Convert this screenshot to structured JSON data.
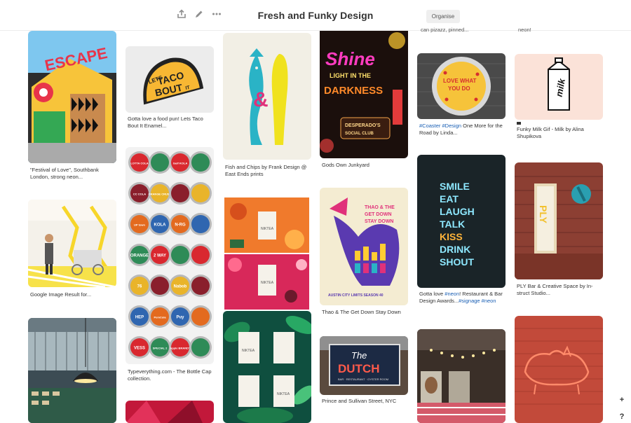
{
  "board": {
    "title": "Fresh and Funky Design",
    "organise_label": "Organise"
  },
  "toolbar": {
    "share_icon": "share-icon",
    "edit_icon": "pencil-icon",
    "more_icon": "more-icon"
  },
  "faded_captions": {
    "col5": "can pizazz, pinned...",
    "col6": "neon!"
  },
  "pins": {
    "festival": {
      "caption": "\"Festival of Love\", Southbank London, strong neon...",
      "sign_text": "ESCAPE"
    },
    "taco": {
      "caption": "Gotta love a food pun! Lets Taco Bout It Enamel...",
      "sign_text": [
        "LETS",
        "TACO",
        "BOUT",
        "IT"
      ]
    },
    "fish": {
      "caption": "Fish and Chips by Frank Design @ East Ends prints"
    },
    "shine": {
      "caption": "Gods Own Junkyard",
      "sign_lines": [
        "Shine",
        "LIGHT IN THE",
        "DARKNESS",
        "DESPERADO'S",
        "SOCIAL CLUB"
      ]
    },
    "coaster": {
      "caption_tag": "#Coaster #Design",
      "caption_rest": " One More for the Road by Linda...",
      "sign_lines": [
        "LOVE WHAT",
        "YOU DO"
      ]
    },
    "milk": {
      "caption_icon": "pin-source-icon",
      "caption": "Funky Milk Gif - Milk by Alina Shupikova",
      "sign_text": "milk"
    },
    "kiosk": {
      "caption": "Google Image Result for..."
    },
    "caps": {
      "caption": "Typeverything.com - The Bottle Cap collection.",
      "labels": [
        "LOTTA COLA",
        "",
        "Gulf KOLA",
        "",
        "CC COLA",
        "ORANGE CRUSH",
        "",
        "",
        "UP town",
        "KOLA",
        "N-RG",
        "",
        "ORANGE",
        "2 WAY",
        "",
        "",
        "76",
        "",
        "Nabob",
        "",
        "HEP",
        "PemCola",
        "Puy",
        "",
        "VESS",
        "SPECIAL 2",
        "Apple BRANDY",
        ""
      ]
    },
    "thao": {
      "caption": "Thao & The Get Down Stay Down",
      "sign_lines": [
        "THAO & THE",
        "GET DOWN",
        "STAY DOWN",
        "AUSTIN CITY LIMITS SEASON 40"
      ]
    },
    "neon": {
      "caption_a": "Gotta love ",
      "caption_tag1": "#neon",
      "caption_b": "! Restaurant & Bar Design Awards...",
      "caption_tag2": "#signage #neon",
      "sign_lines": [
        "SMILE",
        "EAT",
        "LAUGH",
        "TALK",
        "KISS",
        "DRINK",
        "SHOUT"
      ]
    },
    "ply": {
      "caption": "PLY Bar & Creative Space by In-struct Studio...",
      "sign_text": "PLY"
    },
    "dutch": {
      "caption": "Prince and Sullivan Street, NYC",
      "sign_lines": [
        "The",
        "DUTCH",
        "BAR · RESTAURANT · OYSTER ROOM"
      ]
    },
    "tea1": {
      "label": "NIKTEA"
    },
    "tea2": {
      "label": "NIKTEA"
    },
    "tea3": {
      "label": "NIKTEA"
    }
  },
  "side_buttons": {
    "plus": "+",
    "help": "?"
  },
  "colors": {
    "accent_blue": "#1a5fb4",
    "neon_cyan": "#8ee8ff",
    "neon_gold": "#ffb43a",
    "neon_pink": "#ff3cc0"
  }
}
